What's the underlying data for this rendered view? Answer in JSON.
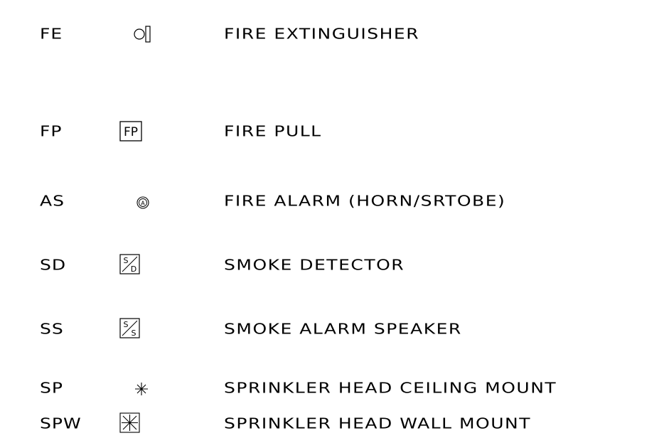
{
  "legend": [
    {
      "abbr": "FE",
      "symbol_icon": "fire-extinguisher-symbol",
      "description": "FIRE EXTINGUISHER"
    },
    {
      "abbr": "FP",
      "symbol_icon": "fire-pull-symbol",
      "symbol_text": "FP",
      "description": "FIRE PULL"
    },
    {
      "abbr": "AS",
      "symbol_icon": "fire-alarm-symbol",
      "symbol_text": "A",
      "description": "FIRE ALARM (HORN/SRTOBE)"
    },
    {
      "abbr": "SD",
      "symbol_icon": "smoke-detector-symbol",
      "symbol_text_top": "S",
      "symbol_text_bottom": "D",
      "description": "SMOKE DETECTOR"
    },
    {
      "abbr": "SS",
      "symbol_icon": "smoke-alarm-speaker-symbol",
      "symbol_text_top": "S",
      "symbol_text_bottom": "S",
      "description": "SMOKE ALARM SPEAKER"
    },
    {
      "abbr": "SP",
      "symbol_icon": "sprinkler-ceiling-symbol",
      "description": "SPRINKLER HEAD CEILING MOUNT"
    },
    {
      "abbr": "SPW",
      "symbol_icon": "sprinkler-wall-symbol",
      "description": "SPRINKLER HEAD WALL MOUNT"
    }
  ]
}
